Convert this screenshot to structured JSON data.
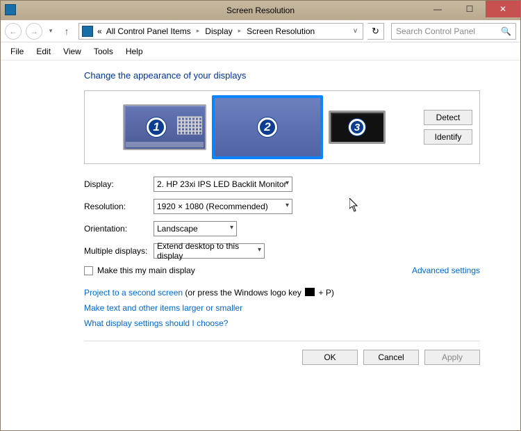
{
  "titlebar": {
    "title": "Screen Resolution"
  },
  "nav": {
    "breadcrumb_prefix": "«",
    "crumb1": "All Control Panel Items",
    "crumb2": "Display",
    "crumb3": "Screen Resolution",
    "search_placeholder": "Search Control Panel"
  },
  "menu": {
    "file": "File",
    "edit": "Edit",
    "view": "View",
    "tools": "Tools",
    "help": "Help"
  },
  "heading": "Change the appearance of your displays",
  "monitors": {
    "m1": "1",
    "m2": "2",
    "m3": "3"
  },
  "side_buttons": {
    "detect": "Detect",
    "identify": "Identify"
  },
  "form": {
    "display_label": "Display:",
    "display_value": "2. HP 23xi IPS LED Backlit Monitor",
    "resolution_label": "Resolution:",
    "resolution_value": "1920 × 1080 (Recommended)",
    "orientation_label": "Orientation:",
    "orientation_value": "Landscape",
    "multi_label": "Multiple displays:",
    "multi_value": "Extend desktop to this display"
  },
  "checkbox": {
    "label": "Make this my main display"
  },
  "advanced": "Advanced settings",
  "links": {
    "project_link": "Project to a second screen",
    "project_suffix": " (or press the Windows logo key ",
    "project_plus": " + P)",
    "textsize": "Make text and other items larger or smaller",
    "which": "What display settings should I choose?"
  },
  "footer": {
    "ok": "OK",
    "cancel": "Cancel",
    "apply": "Apply"
  }
}
